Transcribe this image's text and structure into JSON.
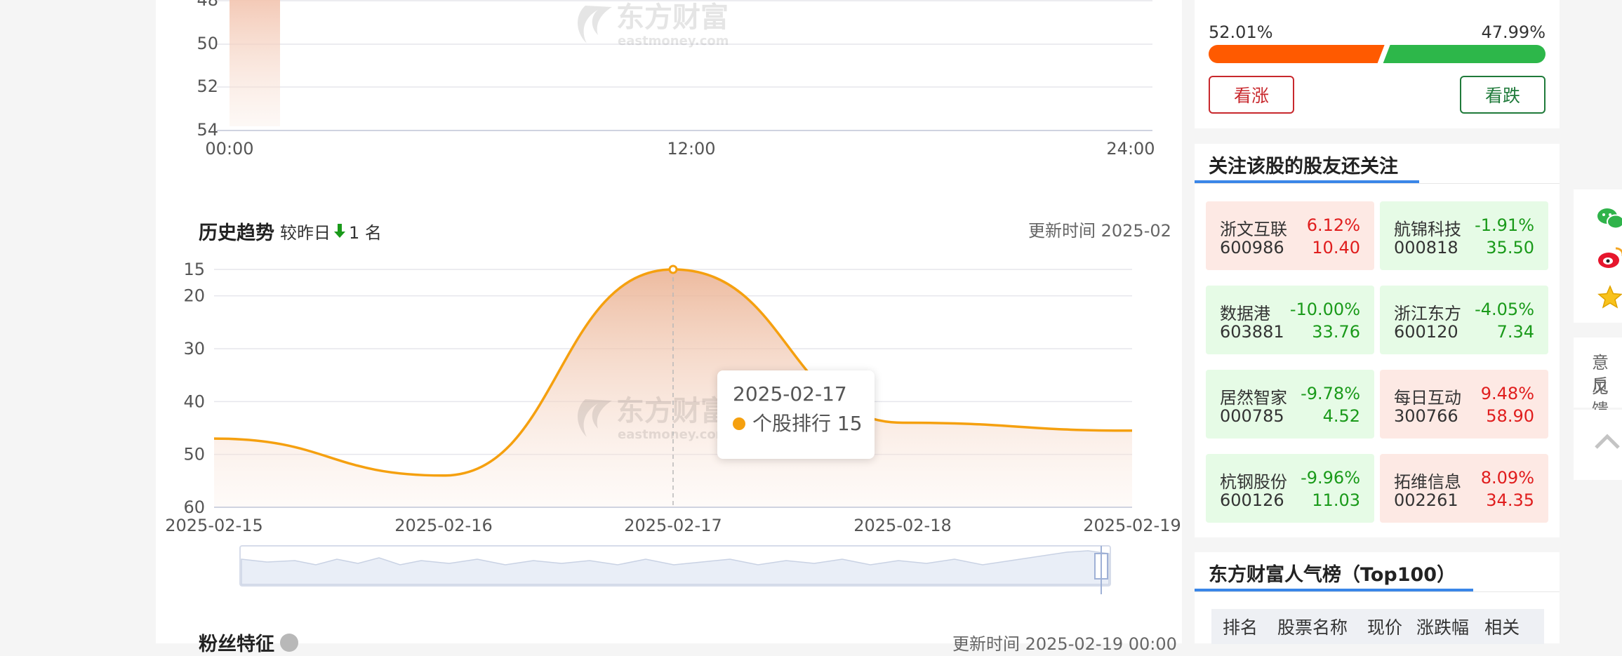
{
  "watermark": {
    "brand_cn": "东方财富",
    "brand_en": "eastmoney.com"
  },
  "intraday": {
    "y_ticks": [
      "48",
      "50",
      "52",
      "54"
    ],
    "x_ticks": [
      "00:00",
      "12:00",
      "24:00"
    ]
  },
  "history": {
    "title": "历史趋势",
    "compare_prefix": "较昨日",
    "compare_value": "1 名",
    "update_time": "更新时间 2025-02",
    "tooltip_date": "2025-02-17",
    "tooltip_text": "个股排行 15",
    "chart_data": {
      "type": "area",
      "x": [
        "2025-02-15",
        "2025-02-16",
        "2025-02-17",
        "2025-02-18",
        "2025-02-19"
      ],
      "series": [
        {
          "values": [
            47,
            54,
            15,
            44,
            45.5
          ]
        }
      ],
      "y_ticks": [
        "15",
        "20",
        "30",
        "40",
        "50",
        "60"
      ],
      "ylim": [
        15,
        60
      ],
      "y_inverted": true,
      "grid": true,
      "line_color": "#f5a00f"
    }
  },
  "fans_section": {
    "title": "粉丝特征",
    "update_time": "更新时间 2025-02-19 00:00"
  },
  "sentiment": {
    "bull_pct": "52.01%",
    "bear_pct": "47.99%",
    "bull_fraction": 0.5201,
    "bull_button": "看涨",
    "bear_button": "看跌",
    "bull_color": "#ff5a00",
    "bear_color": "#2db74a"
  },
  "related": {
    "title": "关注该股的股友还关注",
    "stocks": [
      {
        "name": "浙文互联",
        "code": "600986",
        "change": "6.12%",
        "price": "10.40",
        "dir": "up"
      },
      {
        "name": "航锦科技",
        "code": "000818",
        "change": "-1.91%",
        "price": "35.50",
        "dir": "down"
      },
      {
        "name": "数据港",
        "code": "603881",
        "change": "-10.00%",
        "price": "33.76",
        "dir": "down"
      },
      {
        "name": "浙江东方",
        "code": "600120",
        "change": "-4.05%",
        "price": "7.34",
        "dir": "down"
      },
      {
        "name": "居然智家",
        "code": "000785",
        "change": "-9.78%",
        "price": "4.52",
        "dir": "down"
      },
      {
        "name": "每日互动",
        "code": "300766",
        "change": "9.48%",
        "price": "58.90",
        "dir": "up"
      },
      {
        "name": "杭钢股份",
        "code": "600126",
        "change": "-9.96%",
        "price": "11.03",
        "dir": "down"
      },
      {
        "name": "拓维信息",
        "code": "002261",
        "change": "8.09%",
        "price": "34.35",
        "dir": "up"
      }
    ]
  },
  "popularity": {
    "title": "东方财富人气榜（Top100）",
    "columns": [
      "排名",
      "股票名称",
      "现价",
      "涨跌幅",
      "相关"
    ]
  },
  "float_bar": {
    "feedback_line1": "意见",
    "feedback_line2": "反馈"
  }
}
